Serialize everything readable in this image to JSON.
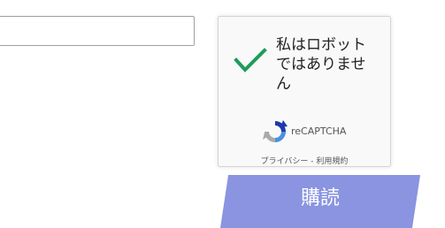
{
  "form": {
    "email_value": "",
    "email_placeholder": ""
  },
  "recaptcha": {
    "checkbox_label": "私はロボットではありません",
    "checked": true,
    "check_color": "#1e9c5a",
    "brand": "reCAPTCHA",
    "privacy_link": "プライバシー",
    "separator": " - ",
    "terms_link": "利用規約"
  },
  "subscribe": {
    "label": "購読",
    "color": "#8a94e0"
  }
}
